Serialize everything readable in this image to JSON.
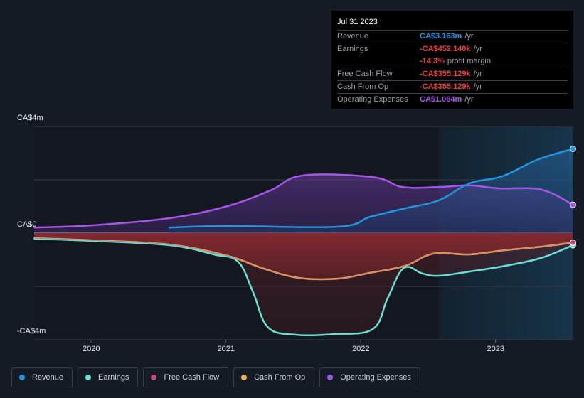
{
  "tooltip": {
    "date": "Jul 31 2023",
    "rows": [
      {
        "label": "Revenue",
        "value": "CA$3.163m",
        "unit": "/yr",
        "color": "#2394df"
      },
      {
        "label": "Earnings",
        "value": "-CA$452.140k",
        "unit": "/yr",
        "color": "#e64141"
      },
      {
        "label": "",
        "value": "-14.3%",
        "unit": "profit margin",
        "color": "#e64141"
      },
      {
        "label": "Free Cash Flow",
        "value": "-CA$355.129k",
        "unit": "/yr",
        "color": "#e64141"
      },
      {
        "label": "Cash From Op",
        "value": "-CA$355.129k",
        "unit": "/yr",
        "color": "#e64141"
      },
      {
        "label": "Operating Expenses",
        "value": "CA$1.064m",
        "unit": "/yr",
        "color": "#a655e8"
      }
    ]
  },
  "legend": [
    {
      "label": "Revenue",
      "color": "#2394df"
    },
    {
      "label": "Earnings",
      "color": "#6ce0d0"
    },
    {
      "label": "Free Cash Flow",
      "color": "#c5487f"
    },
    {
      "label": "Cash From Op",
      "color": "#e8b060"
    },
    {
      "label": "Operating Expenses",
      "color": "#a655e8"
    }
  ],
  "chart_data": {
    "type": "area",
    "title": "",
    "xlabel": "",
    "ylabel": "",
    "units": "CA$ millions",
    "x_range": [
      2019.58,
      2023.58
    ],
    "ylim": [
      -4,
      4
    ],
    "y_ticks": [
      {
        "value": 4,
        "label": "CA$4m"
      },
      {
        "value": 0,
        "label": "CA$0"
      },
      {
        "value": -4,
        "label": "-CA$4m"
      }
    ],
    "x_ticks": [
      {
        "value": 2020,
        "label": "2020"
      },
      {
        "value": 2021,
        "label": "2021"
      },
      {
        "value": 2022,
        "label": "2022"
      },
      {
        "value": 2023,
        "label": "2023"
      }
    ],
    "highlight_from": 2022.58,
    "grid": true,
    "legend_position": "bottom",
    "series": [
      {
        "name": "Operating Expenses",
        "color": "#a655e8",
        "x": [
          2019.58,
          2020.0,
          2020.58,
          2021.01,
          2021.33,
          2021.57,
          2022.09,
          2022.31,
          2022.58,
          2022.81,
          2023.02,
          2023.34,
          2023.575
        ],
        "values": [
          0.21,
          0.29,
          0.56,
          1.01,
          1.6,
          2.16,
          2.1,
          1.73,
          1.73,
          1.79,
          1.68,
          1.63,
          1.064
        ]
      },
      {
        "name": "Revenue",
        "color": "#2394df",
        "x": [
          2020.58,
          2021.01,
          2021.83,
          2022.07,
          2022.33,
          2022.58,
          2022.81,
          2023.05,
          2023.31,
          2023.575
        ],
        "values": [
          0.21,
          0.27,
          0.24,
          0.61,
          0.93,
          1.23,
          1.87,
          2.13,
          2.75,
          3.163
        ]
      },
      {
        "name": "Free Cash Flow",
        "color": "#c5487f",
        "x": [
          2019.58,
          2020.0,
          2020.58,
          2021.01,
          2021.28,
          2021.54,
          2021.83,
          2022.07,
          2022.33,
          2022.54,
          2022.81,
          2023.07,
          2023.34,
          2023.575
        ],
        "values": [
          -0.19,
          -0.27,
          -0.43,
          -0.85,
          -1.33,
          -1.68,
          -1.71,
          -1.49,
          -1.23,
          -0.77,
          -0.8,
          -0.64,
          -0.51,
          -0.355
        ]
      },
      {
        "name": "Cash From Op",
        "color": "#e8b060",
        "x": [
          2019.58,
          2020.0,
          2020.58,
          2021.01,
          2021.28,
          2021.54,
          2021.83,
          2022.07,
          2022.33,
          2022.54,
          2022.81,
          2023.07,
          2023.34,
          2023.575
        ],
        "values": [
          -0.19,
          -0.27,
          -0.43,
          -0.85,
          -1.33,
          -1.68,
          -1.71,
          -1.49,
          -1.23,
          -0.77,
          -0.8,
          -0.64,
          -0.51,
          -0.355
        ]
      },
      {
        "name": "Earnings",
        "color": "#6ce0d0",
        "x": [
          2019.58,
          2020.0,
          2020.58,
          2020.91,
          2021.09,
          2021.2,
          2021.31,
          2021.51,
          2021.8,
          2022.09,
          2022.2,
          2022.32,
          2022.46,
          2022.58,
          2022.81,
          2023.07,
          2023.34,
          2023.575
        ],
        "values": [
          -0.21,
          -0.29,
          -0.45,
          -0.8,
          -1.07,
          -2.19,
          -3.52,
          -3.81,
          -3.79,
          -3.6,
          -2.45,
          -1.31,
          -1.52,
          -1.6,
          -1.44,
          -1.23,
          -0.93,
          -0.452
        ]
      }
    ]
  }
}
